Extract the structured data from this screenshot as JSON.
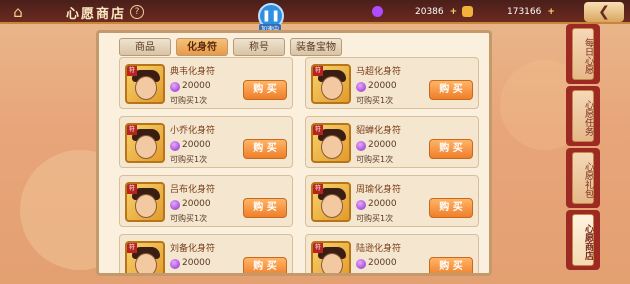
{
  "header": {
    "title": "心愿商店",
    "help_label": "?",
    "home_icon": "palace-icon",
    "pause_label": "加速中",
    "currencies": [
      {
        "icon": "purple-gem-icon",
        "value": "20386",
        "color": "#b04cff"
      },
      {
        "icon": "gold-ingot-icon",
        "value": "173166",
        "color": "#f2b23a"
      }
    ],
    "back_icon": "back-arrow-icon"
  },
  "tabs": [
    {
      "label": "商品",
      "active": false
    },
    {
      "label": "化身符",
      "active": true
    },
    {
      "label": "称号",
      "active": false
    },
    {
      "label": "装备宝物",
      "active": false
    }
  ],
  "items": [
    {
      "name": "典韦化身符",
      "price": "20000",
      "limit": "可购买1次",
      "buy": "购 买"
    },
    {
      "name": "马超化身符",
      "price": "20000",
      "limit": "可购买1次",
      "buy": "购 买"
    },
    {
      "name": "小乔化身符",
      "price": "20000",
      "limit": "可购买1次",
      "buy": "购 买"
    },
    {
      "name": "貂蝉化身符",
      "price": "20000",
      "limit": "可购买1次",
      "buy": "购 买"
    },
    {
      "name": "吕布化身符",
      "price": "20000",
      "limit": "可购买1次",
      "buy": "购 买"
    },
    {
      "name": "周瑜化身符",
      "price": "20000",
      "limit": "可购买1次",
      "buy": "购 买"
    },
    {
      "name": "刘备化身符",
      "price": "20000",
      "limit": "",
      "buy": "购 买"
    },
    {
      "name": "陆逊化身符",
      "price": "20000",
      "limit": "",
      "buy": "购 买"
    }
  ],
  "sidebar": [
    {
      "label": "每日心愿",
      "active": false
    },
    {
      "label": "心愿任务",
      "active": false
    },
    {
      "label": "心愿礼包",
      "active": false
    },
    {
      "label": "心愿商店",
      "active": true
    }
  ]
}
